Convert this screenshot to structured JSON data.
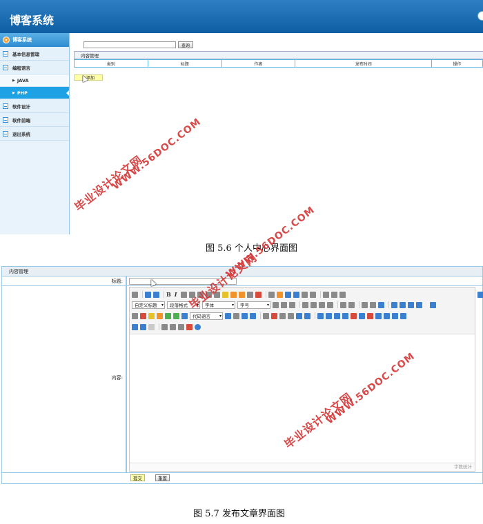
{
  "shot1": {
    "app_title": "博客系统",
    "sidebar": {
      "head": "博客系统",
      "items": [
        {
          "label": "基本信息管理"
        },
        {
          "label": "编程语言"
        },
        {
          "label": "JAVA"
        },
        {
          "label": "PHP"
        },
        {
          "label": "软件设计"
        },
        {
          "label": "软件前端"
        },
        {
          "label": "退出系统"
        }
      ]
    },
    "search": {
      "button": "查询",
      "value": ""
    },
    "panel_title": "内容管理",
    "columns": [
      "类别",
      "标题",
      "作者",
      "发布时间",
      "操作"
    ],
    "add_button": "添加"
  },
  "caption1": "图 5.6 个人中心界面图",
  "shot2": {
    "panel_title": "内容管理",
    "title_label": "标题:",
    "content_label": "内容:",
    "toolbar": {
      "bold": "B",
      "italic": "I",
      "sel_heading": "自定义标题",
      "sel_paragraph": "段落格式",
      "sel_font": "字体",
      "sel_size": "字号",
      "sel_code": "代码语言"
    },
    "word_count": "字数统计",
    "submit": "提交",
    "reset": "重置"
  },
  "caption2": "图 5.7 发布文章界面图",
  "watermark": {
    "line1": "毕业设计论文网",
    "line2": "WWW.56DOC.COM"
  }
}
